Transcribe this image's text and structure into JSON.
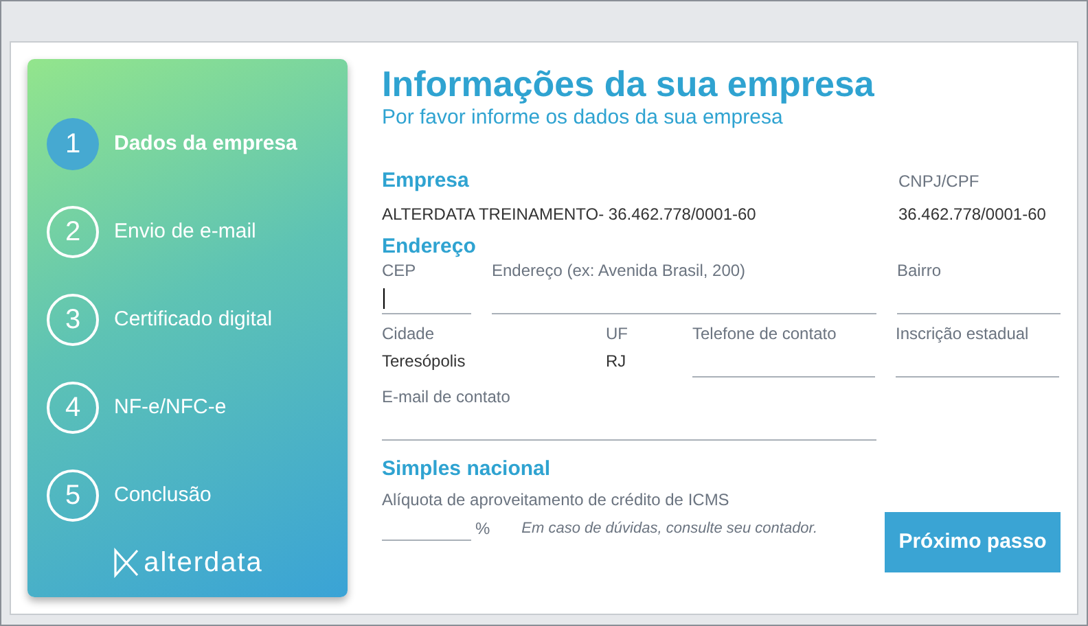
{
  "steps": [
    {
      "number": "1",
      "label": "Dados da empresa",
      "selected": true
    },
    {
      "number": "2",
      "label": "Envio de e-mail",
      "selected": false
    },
    {
      "number": "3",
      "label": "Certificado digital",
      "selected": false
    },
    {
      "number": "4",
      "label": "NF-e/NFC-e",
      "selected": false
    },
    {
      "number": "5",
      "label": "Conclusão",
      "selected": false
    }
  ],
  "brand": "alterdata",
  "title": "Informações da sua empresa",
  "subtitle": "Por favor informe os dados da sua empresa",
  "empresa": {
    "heading": "Empresa",
    "value": "ALTERDATA TREINAMENTO- 36.462.778/0001-60",
    "cnpj_label": "CNPJ/CPF",
    "cnpj_value": "36.462.778/0001-60"
  },
  "endereco": {
    "heading": "Endereço",
    "cep": {
      "label": "CEP",
      "focused": true
    },
    "logradouro": {
      "label": "Endereço (ex: Avenida Brasil, 200)",
      "focused": false
    },
    "bairro": {
      "label": "Bairro",
      "focused": false
    },
    "cidade": {
      "label": "Cidade",
      "value": "Teresópolis"
    },
    "uf": {
      "label": "UF",
      "value": "RJ"
    },
    "telefone": {
      "label": "Telefone de contato",
      "focused": false
    },
    "inscricao": {
      "label": "Inscrição estadual",
      "focused": false
    },
    "email": {
      "label": "E-mail de contato",
      "focused": false
    }
  },
  "simples": {
    "heading": "Simples nacional",
    "label": "Alíquota de aproveitamento de crédito de ICMS",
    "unit": "%",
    "hint": "Em caso de dúvidas, consulte seu contador."
  },
  "next_button": "Próximo passo"
}
